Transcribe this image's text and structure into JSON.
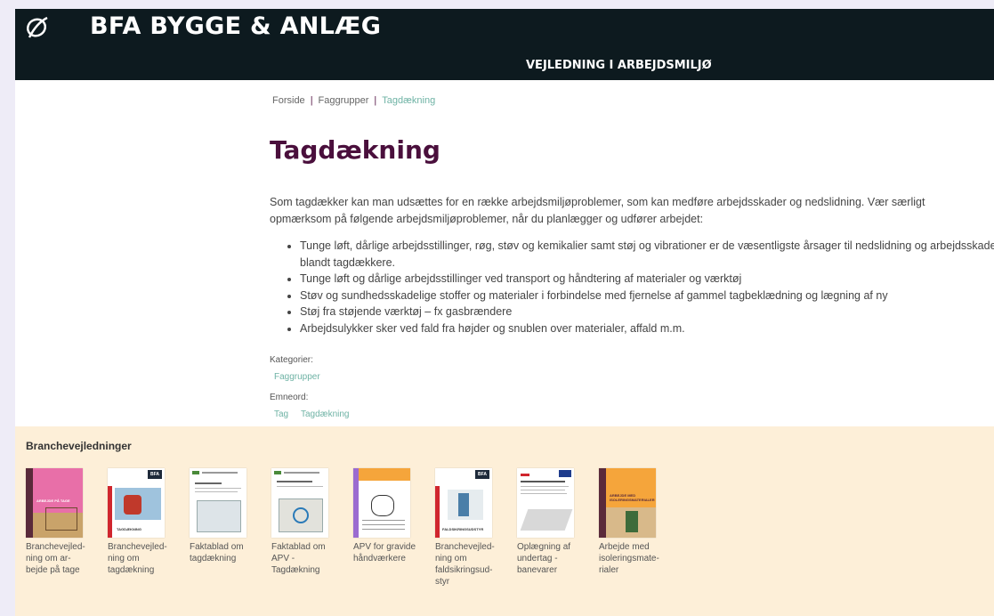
{
  "header": {
    "brand": "BFA BYGGE & ANLÆG",
    "subtitle": "VEJLEDNING I ARBEJDSMILJØ"
  },
  "breadcrumb": {
    "items": [
      "Forside",
      "Faggrupper"
    ],
    "current": "Tagdækning"
  },
  "page_title": "Tagdækning",
  "intro": "Som tagdækker kan man udsættes for en række arbejdsmiljøproblemer, som kan medføre arbejdsskader og nedslidning. Vær særligt opmærksom på følgende arbejdsmiljøproblemer, når du planlægger og udfører arbejdet:",
  "issues": [
    "Tunge løft, dårlige arbejdsstillinger, røg, støv og kemikalier samt støj og vibrationer er de væsentligste årsager til nedslidning og arbejdsskader blandt tagdækkere.",
    "Tunge løft og dårlige arbejdsstillinger ved transport og håndtering af materialer og værktøj",
    "Støv og sundhedsskadelige stoffer og materialer i forbindelse med fjernelse af gammel tagbeklædning og lægning af ny",
    "Støj fra støjende værktøj – fx gasbrændere",
    "Arbejdsulykker sker ved fald fra højder og snublen over materialer, affald m.m."
  ],
  "categories": {
    "label": "Kategorier:",
    "items": [
      "Faggrupper"
    ]
  },
  "keywords": {
    "label": "Emneord:",
    "items": [
      "Tag",
      "Tagdækning"
    ]
  },
  "branche": {
    "title": "Branchevejledninger",
    "items": [
      {
        "label": "Branchevejled-ning om ar-bejde på tage",
        "cover_text": "ARBEJDE PÅ TAGE",
        "accent": "#e86fa8"
      },
      {
        "label": "Branchevejled-ning om tagdækning",
        "cover_text": "TAGDÆKNING",
        "accent": "#d0262e"
      },
      {
        "label": "Faktablad om tagdækning",
        "cover_text": "",
        "accent": "#4a8a3a"
      },
      {
        "label": "Faktablad om APV - Tagdækning",
        "cover_text": "",
        "accent": "#4a8a3a"
      },
      {
        "label": "APV for gravide håndværkere",
        "cover_text": "",
        "accent": "#9b6bd0"
      },
      {
        "label": "Branchevejled-ning om faldsikringsud-styr",
        "cover_text": "FALDSIKRINGSUDSTYR",
        "accent": "#d0262e"
      },
      {
        "label": "Oplægning af undertag - banevarer",
        "cover_text": "",
        "accent": "#1e3c8c"
      },
      {
        "label": "Arbejde med isoleringsmate-rialer",
        "cover_text": "ARBEJDE MED ISOLERINGSMATERIALER",
        "accent": "#f5a53b"
      }
    ]
  }
}
